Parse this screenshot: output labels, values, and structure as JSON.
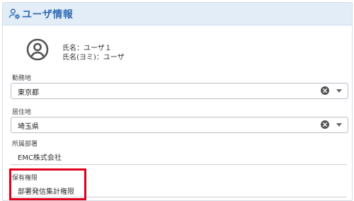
{
  "header": {
    "title": "ユーザ情報",
    "icon": "user-gear-icon",
    "accent_color": "#2f6cb3"
  },
  "profile": {
    "avatar_icon": "account-circle-icon",
    "name_line": "氏名：ユーザ１",
    "kana_line": "氏名(ヨミ)：ユーザ"
  },
  "fields": {
    "workplace": {
      "label": "勤務地",
      "value": "東京都"
    },
    "residence": {
      "label": "居住地",
      "value": "埼玉県"
    },
    "department": {
      "label": "所属部署",
      "value": "EMC株式会社"
    },
    "permission": {
      "label": "保有権限",
      "value": "部署発信集計権限"
    }
  },
  "highlight_color": "#e0001b"
}
